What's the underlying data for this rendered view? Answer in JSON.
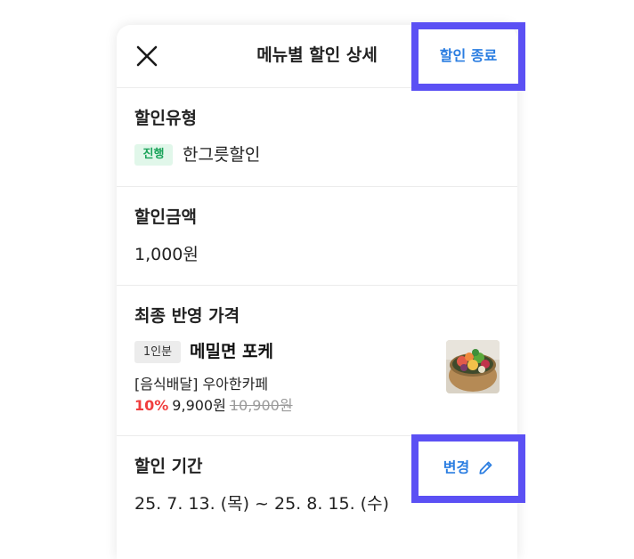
{
  "header": {
    "title": "메뉴별 할인 상세",
    "end_discount_label": "할인 종료",
    "close_icon": "close-icon"
  },
  "discount_type": {
    "label": "할인유형",
    "status_badge": "진행",
    "value": "한그릇할인"
  },
  "discount_amount": {
    "label": "할인금액",
    "value": "1,000원"
  },
  "final_price": {
    "label": "최종 반영 가격",
    "serving_badge": "1인분",
    "menu_name": "메밀면 포케",
    "shop_name": "[음식배달] 우아한카페",
    "discount_rate": "10%",
    "discounted_price": "9,900원",
    "original_price": "10,900원"
  },
  "discount_period": {
    "label": "할인 기간",
    "value": "25. 7. 13. (목) ~ 25. 8. 15. (수)",
    "change_label": "변경",
    "change_icon": "pencil-icon"
  },
  "colors": {
    "accent_blue": "#2a7de1",
    "highlight_purple": "#5b50f4",
    "discount_red": "#f03e3e",
    "status_green": "#1aa35a",
    "status_green_bg": "#e1f7ea"
  }
}
